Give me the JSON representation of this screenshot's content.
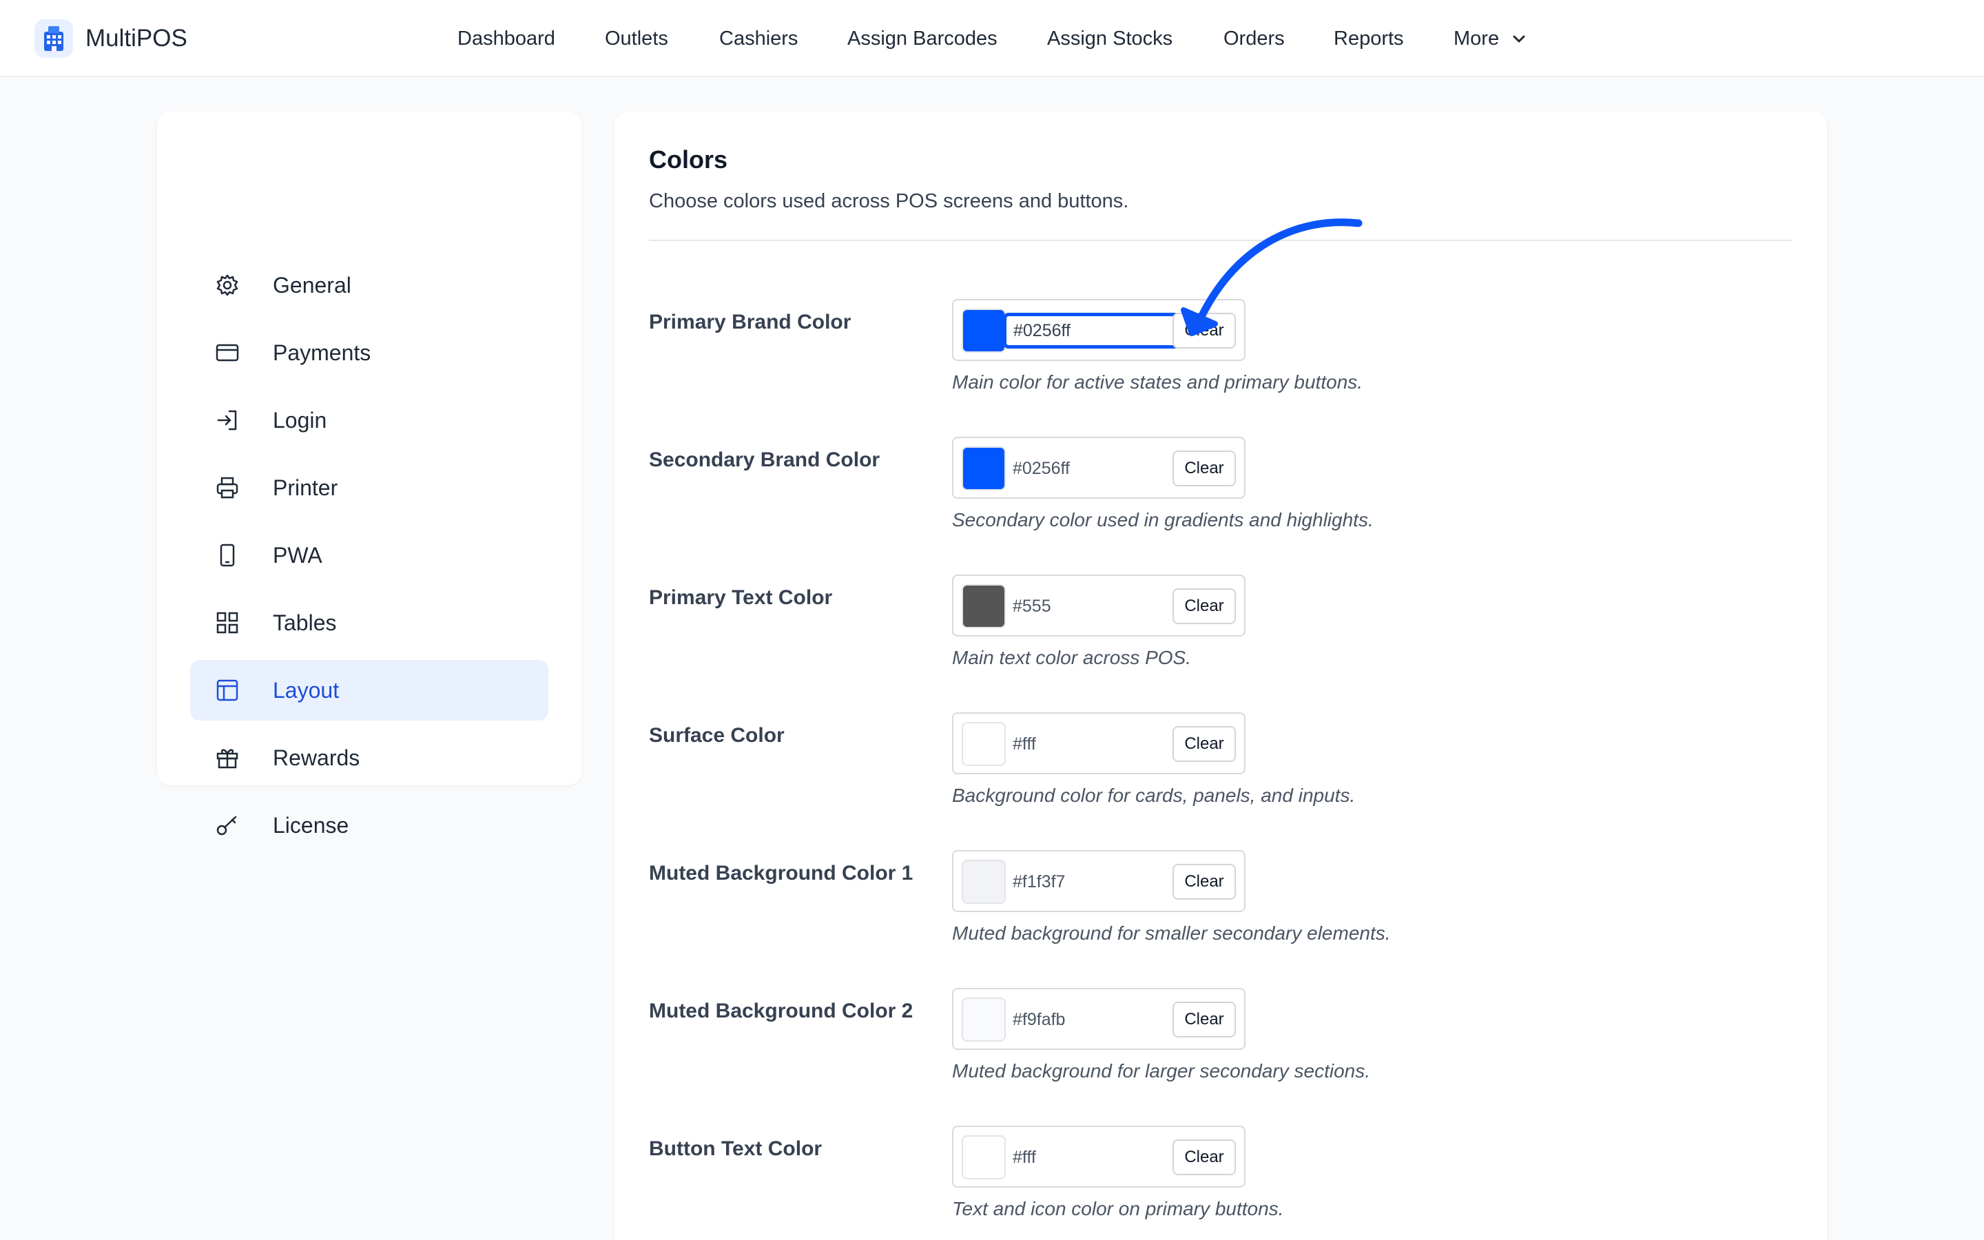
{
  "app": {
    "name": "MultiPOS"
  },
  "nav": [
    {
      "label": "Dashboard"
    },
    {
      "label": "Outlets"
    },
    {
      "label": "Cashiers"
    },
    {
      "label": "Assign Barcodes"
    },
    {
      "label": "Assign Stocks"
    },
    {
      "label": "Orders"
    },
    {
      "label": "Reports"
    },
    {
      "label": "More"
    }
  ],
  "sidebar": {
    "items": [
      {
        "label": "General",
        "icon": "gear-icon"
      },
      {
        "label": "Payments",
        "icon": "credit-card-icon"
      },
      {
        "label": "Login",
        "icon": "login-icon"
      },
      {
        "label": "Printer",
        "icon": "printer-icon"
      },
      {
        "label": "PWA",
        "icon": "mobile-device-icon"
      },
      {
        "label": "Tables",
        "icon": "grid-icon"
      },
      {
        "label": "Layout",
        "icon": "layout-icon",
        "active": true
      },
      {
        "label": "Rewards",
        "icon": "gift-icon"
      },
      {
        "label": "License",
        "icon": "key-icon"
      }
    ]
  },
  "section": {
    "title": "Colors",
    "subtitle": "Choose colors used across POS screens and buttons."
  },
  "clear_label": "Clear",
  "colors": [
    {
      "label": "Primary Brand Color",
      "value": "#0256ff",
      "swatch": "#0256ff",
      "help": "Main color for active states and primary buttons.",
      "focused": true
    },
    {
      "label": "Secondary Brand Color",
      "value": "#0256ff",
      "swatch": "#0256ff",
      "help": "Secondary color used in gradients and highlights."
    },
    {
      "label": "Primary Text Color",
      "value": "#555",
      "swatch": "#555555",
      "help": "Main text color across POS."
    },
    {
      "label": "Surface Color",
      "value": "#fff",
      "swatch": "#ffffff",
      "help": "Background color for cards, panels, and inputs."
    },
    {
      "label": "Muted Background Color 1",
      "value": "#f1f3f7",
      "swatch": "#f1f3f7",
      "help": "Muted background for smaller secondary elements."
    },
    {
      "label": "Muted Background Color 2",
      "value": "#f9fafb",
      "swatch": "#f9fafb",
      "help": "Muted background for larger secondary sections."
    },
    {
      "label": "Button Text Color",
      "value": "#fff",
      "swatch": "#ffffff",
      "help": "Text and icon color on primary buttons."
    }
  ],
  "theme": {
    "accent": "#0b54f7",
    "active_bg": "#eaf1fe"
  }
}
